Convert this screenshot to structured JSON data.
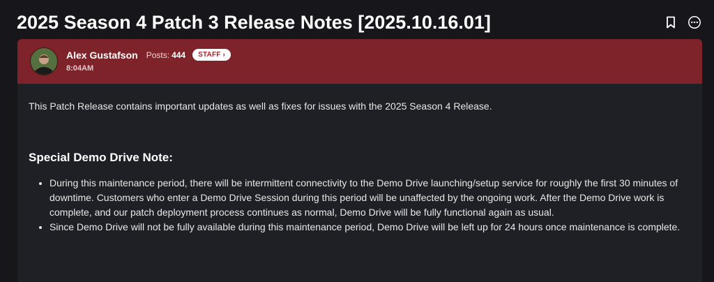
{
  "topic": {
    "title": "2025 Season 4 Patch 3 Release Notes [2025.10.16.01]",
    "bookmark_icon": "bookmark-icon",
    "more_icon": "more-options-icon"
  },
  "post": {
    "author": "Alex Gustafson",
    "posts_label": "Posts:",
    "posts_count": "444",
    "badge": "STAFF ›",
    "time": "8:04AM",
    "intro": "This Patch Release contains important updates as well as fixes for issues with the 2025 Season 4 Release.",
    "section_heading": "Special Demo Drive Note:",
    "bullets": [
      "During this maintenance period, there will be intermittent connectivity to the Demo Drive launching/setup service for roughly the first 30 minutes of downtime. Customers who enter a Demo Drive Session during this period will be unaffected by the ongoing work. After the Demo Drive work is complete, and our patch deployment process continues as normal, Demo Drive will be fully functional again as usual.",
      "Since Demo Drive will not be fully available during this maintenance period, Demo Drive will be left up for 24 hours once maintenance is complete."
    ]
  },
  "colors": {
    "header_bg": "#7e2329",
    "card_bg": "#1f2026",
    "page_bg": "#16161b",
    "badge_text": "#b0202a"
  }
}
